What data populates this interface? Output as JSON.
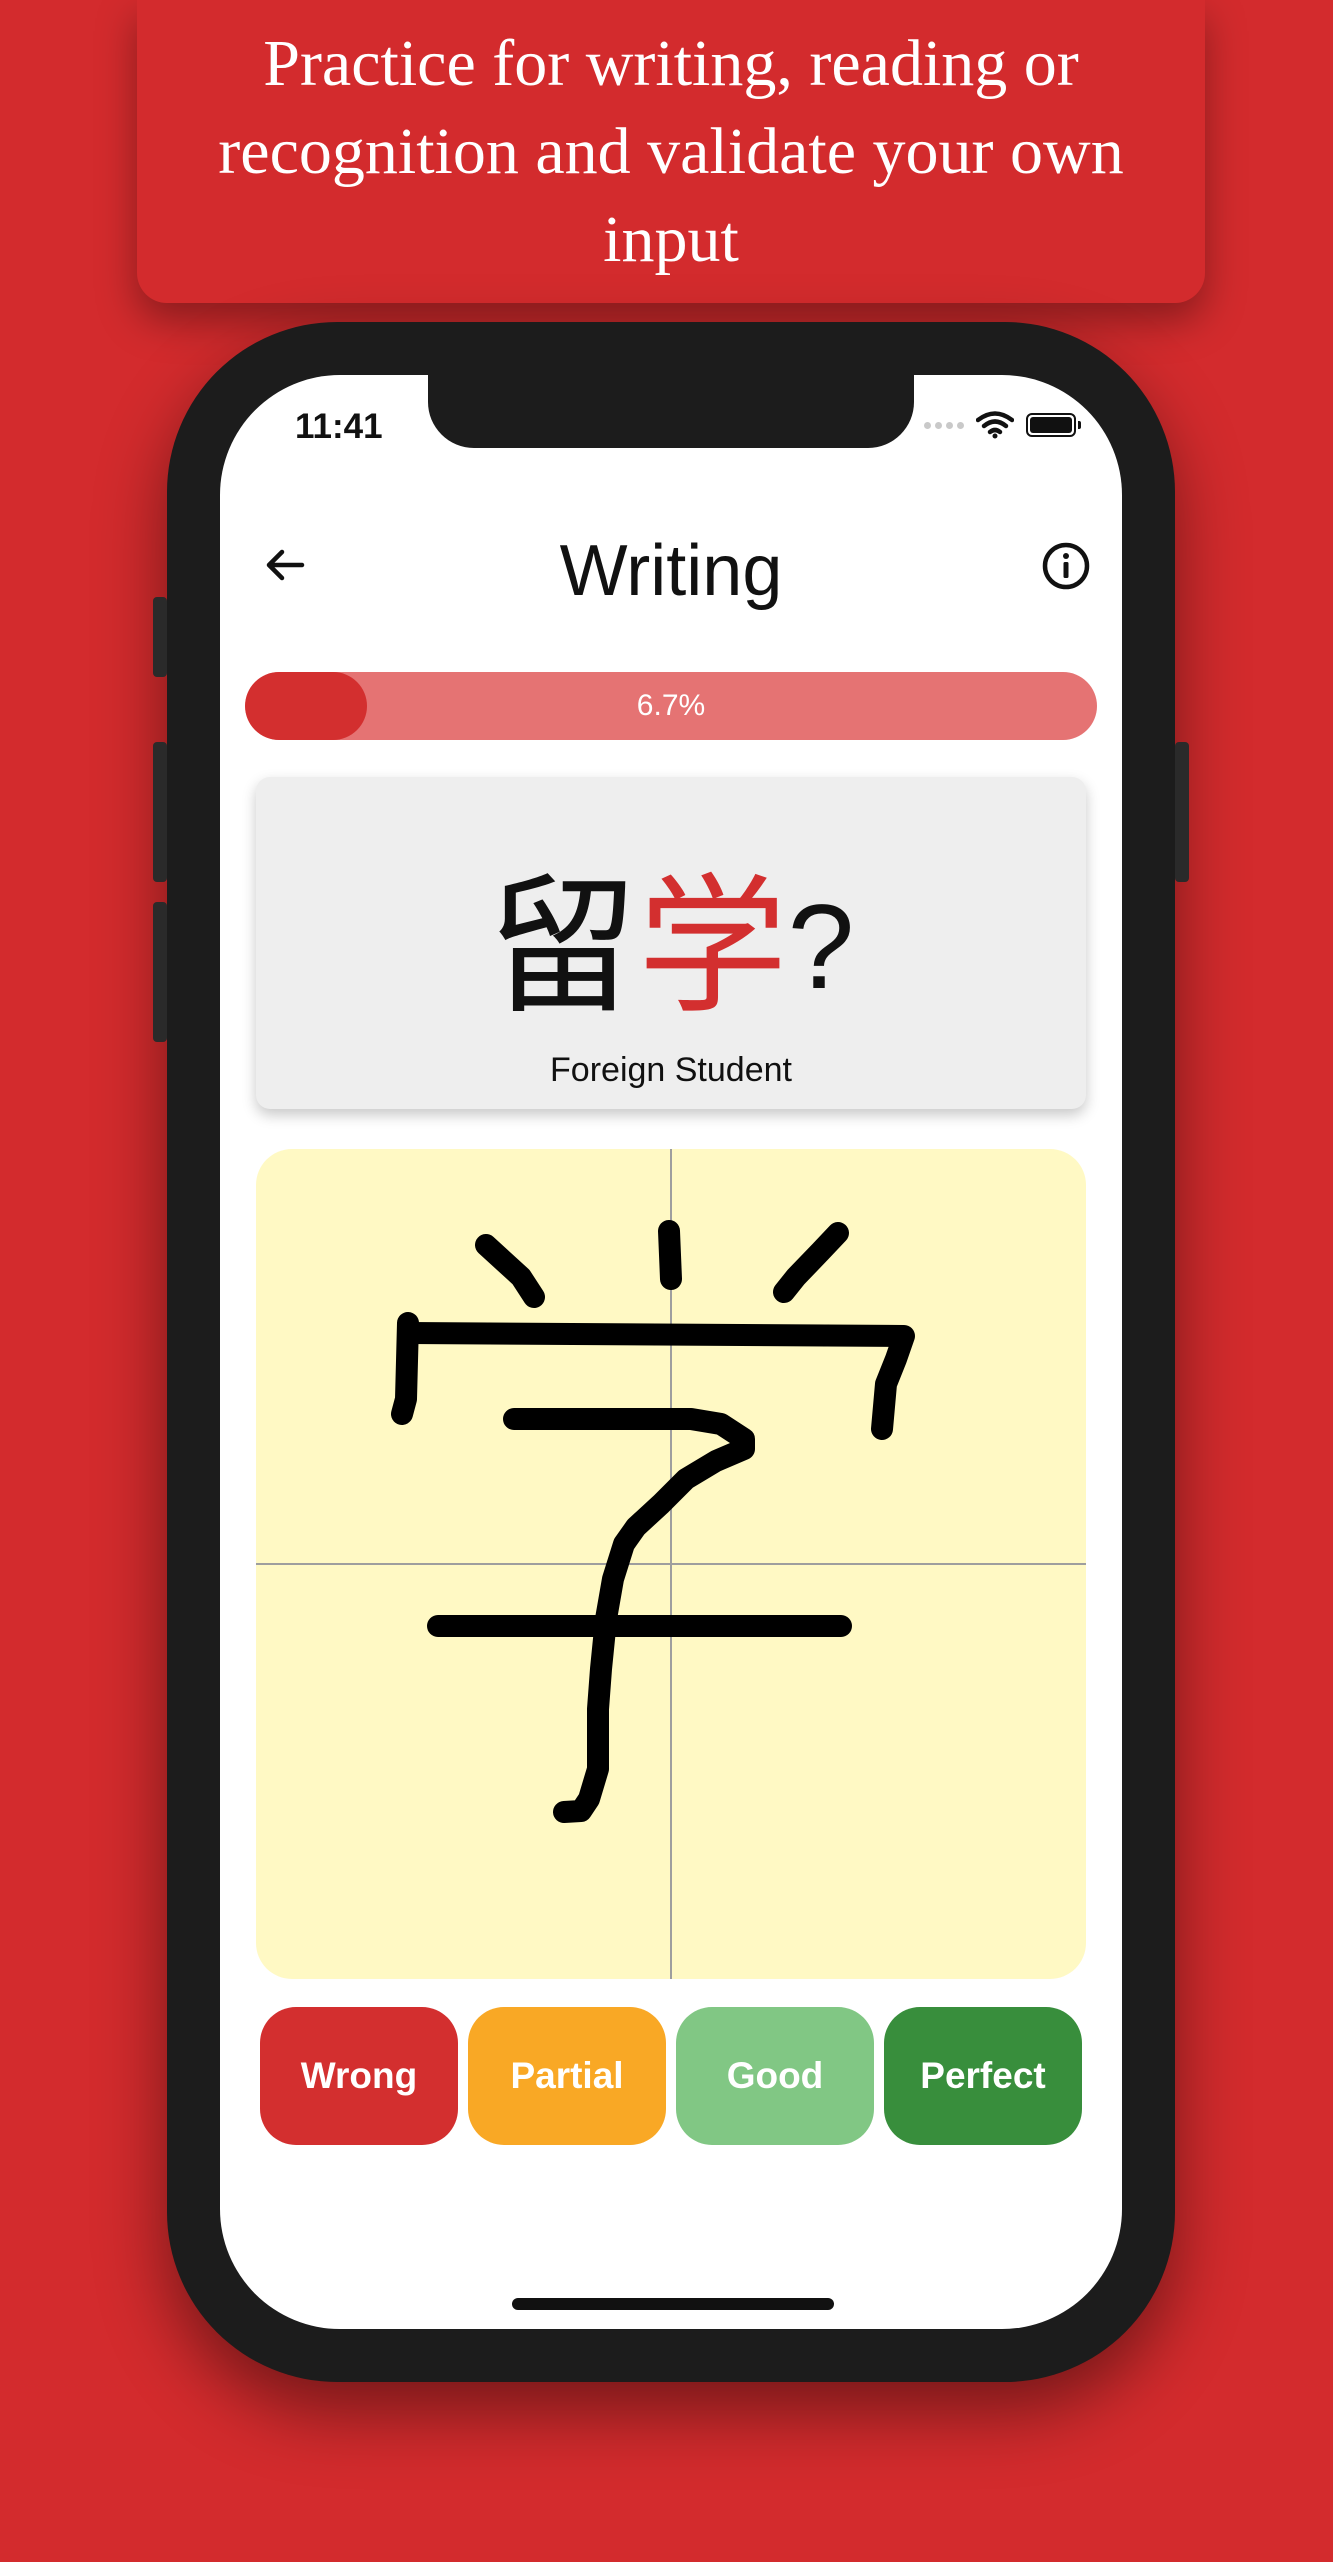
{
  "banner": {
    "text": "Practice for writing, reading or recognition and validate your own input"
  },
  "status_bar": {
    "time": "11:41",
    "icons": [
      "signal-dots-icon",
      "wifi-icon",
      "battery-icon"
    ]
  },
  "header": {
    "title": "Writing",
    "back_icon": "arrow-left-icon",
    "info_icon": "info-circle-icon"
  },
  "progress": {
    "value": 0.067,
    "label": "6.7%"
  },
  "card": {
    "char1": "留",
    "char2": "学",
    "suffix": "?",
    "meaning": "Foreign Student"
  },
  "canvas": {
    "description_icon": "handwriting-canvas"
  },
  "rating_buttons": [
    {
      "label": "Wrong",
      "color": "#d32f2f"
    },
    {
      "label": "Partial",
      "color": "#f9a825"
    },
    {
      "label": "Good",
      "color": "#81c784"
    },
    {
      "label": "Perfect",
      "color": "#388e3c"
    }
  ],
  "colors": {
    "brand_red": "#d32b2d",
    "canvas_bg": "#fff9c4"
  }
}
